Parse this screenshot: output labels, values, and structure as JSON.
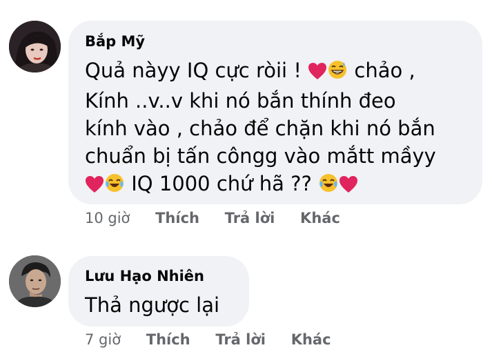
{
  "comments": [
    {
      "author": "Bắp Mỹ",
      "lines": [
        [
          "Quả nàyy IQ cực ròii ! ",
          "heart-icon",
          "grin-sweat-icon",
          " chảo ,"
        ],
        [
          "Kính ..v..v khi nó bắn thính đeo"
        ],
        [
          "kính vào , chảo để chặn khi nó bắn"
        ],
        [
          "chuẩn bị tấn côngg vào mắtt mầyy"
        ],
        [
          "heart-icon",
          "tears-of-joy-icon",
          " IQ 1000 chứ hã ?? ",
          "tears-of-joy-icon",
          "heart-icon"
        ]
      ],
      "text_parts": {
        "l1a": "Quả nàyy IQ cực ròii ! ",
        "l1b": " chảo ,",
        "l2": "Kính ..v..v khi nó bắn thính đeo",
        "l3": "kính vào , chảo để chặn khi nó bắn",
        "l4": "chuẩn bị tấn côngg vào mắtt mầyy",
        "l5": " IQ 1000 chứ hã ?? "
      },
      "time": "10 giờ",
      "actions": {
        "like": "Thích",
        "reply": "Trả lời",
        "more": "Khác"
      }
    },
    {
      "author": "Lưu Hạo Nhiên",
      "text": "Thả ngược lại",
      "time": "7 giờ",
      "actions": {
        "like": "Thích",
        "reply": "Trả lời",
        "more": "Khác"
      }
    }
  ],
  "colors": {
    "bubble": "#f0f2f5",
    "text": "#050505",
    "meta": "#65676b",
    "heart": "#e0245e",
    "emoji_face": "#f7c12d"
  }
}
